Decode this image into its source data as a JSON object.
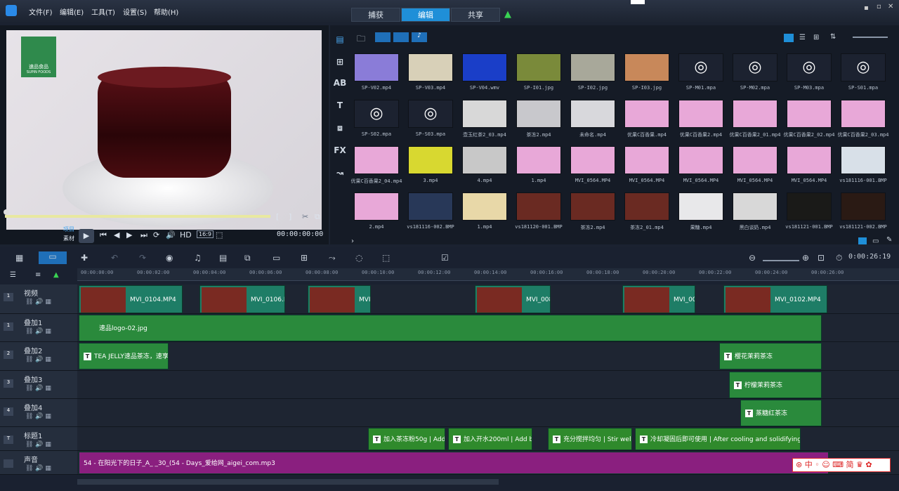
{
  "menu": [
    "文件(F)",
    "编辑(E)",
    "工具(T)",
    "设置(S)",
    "帮助(H)"
  ],
  "tabs": [
    "捕获",
    "编辑",
    "共享"
  ],
  "preview": {
    "logo_text": "速品食品",
    "logo_sub": "SUPIN FOODS",
    "mode_project": "项目",
    "mode_clip": "素材",
    "hd": "HD",
    "aspect": "16:9",
    "timecode": "00:00:00:00"
  },
  "library": {
    "items": [
      {
        "label": "SP-V02.mp4",
        "color": "#8a7cd8"
      },
      {
        "label": "SP-V03.mp4",
        "color": "#d8d0b8"
      },
      {
        "label": "SP-V04.wmv",
        "color": "#1a3ec8"
      },
      {
        "label": "SP-I01.jpg",
        "color": "#7a8a3a"
      },
      {
        "label": "SP-I02.jpg",
        "color": "#a8a89a"
      },
      {
        "label": "SP-I03.jpg",
        "color": "#c8885a"
      },
      {
        "label": "SP-M01.mpa",
        "color": "#1c2230"
      },
      {
        "label": "SP-M02.mpa",
        "color": "#1c2230"
      },
      {
        "label": "SP-M03.mpa",
        "color": "#1c2230"
      },
      {
        "label": "SP-S01.mpa",
        "color": "#1c2230"
      },
      {
        "label": "SP-S02.mpa",
        "color": "#1c2230"
      },
      {
        "label": "SP-S03.mpa",
        "color": "#1c2230"
      },
      {
        "label": "壶玉红茶2_03.mp4",
        "color": "#d8d8d8"
      },
      {
        "label": "茶冻2.mp4",
        "color": "#c8c8cc"
      },
      {
        "label": "未命名.mp4",
        "color": "#d8d8dc"
      },
      {
        "label": "优果C百香果.mp4",
        "color": "#e8a8d8"
      },
      {
        "label": "优果C百香果2.mp4",
        "color": "#e8a8d8"
      },
      {
        "label": "优果C百香果2_01.mp4",
        "color": "#e8a8d8"
      },
      {
        "label": "优果C百香果2_02.mp4",
        "color": "#e8a8d8"
      },
      {
        "label": "优果C百香果2_03.mp4",
        "color": "#e8a8d8"
      },
      {
        "label": "优果C百香果2_04.mp4",
        "color": "#e8a8d8"
      },
      {
        "label": "3.mp4",
        "color": "#d8d830"
      },
      {
        "label": "4.mp4",
        "color": "#c8c8c8"
      },
      {
        "label": "1.mp4",
        "color": "#e8a8d8"
      },
      {
        "label": "MVI_0564.MP4",
        "color": "#e8a8d8"
      },
      {
        "label": "MVI_0564.MP4",
        "color": "#e8a8d8"
      },
      {
        "label": "MVI_0564.MP4",
        "color": "#e8a8d8"
      },
      {
        "label": "MVI_0564.MP4",
        "color": "#e8a8d8"
      },
      {
        "label": "MVI_0564.MP4",
        "color": "#e8a8d8"
      },
      {
        "label": "vs181116-001.BMP",
        "color": "#d8e0e8"
      },
      {
        "label": "2.mp4",
        "color": "#e8a8d8"
      },
      {
        "label": "vs181116-002.BMP",
        "color": "#283858"
      },
      {
        "label": "1.mp4",
        "color": "#e8d8a8"
      },
      {
        "label": "vs181120-001.BMP",
        "color": "#6a2a22"
      },
      {
        "label": "茶冻2.mp4",
        "color": "#6a2a22"
      },
      {
        "label": "茶冻2_01.mp4",
        "color": "#6a2a22"
      },
      {
        "label": "果糖.mp4",
        "color": "#e8e8ea"
      },
      {
        "label": "黑白谈奶.mp4",
        "color": "#d8d8d8"
      },
      {
        "label": "vs181121-001.BMP",
        "color": "#1a1a18"
      },
      {
        "label": "vs181121-002.BMP",
        "color": "#2a1a14"
      }
    ]
  },
  "timeline": {
    "timecode": "0:00:26:19",
    "ruler": [
      "00:00:00:00",
      "00:00:02:00",
      "00:00:04:00",
      "00:00:06:00",
      "00:00:08:00",
      "00:00:10:00",
      "00:00:12:00",
      "00:00:14:00",
      "00:00:16:00",
      "00:00:18:00",
      "00:00:20:00",
      "00:00:22:00",
      "00:00:24:00",
      "00:00:26:00"
    ],
    "tracks": [
      {
        "name": "视频",
        "badge": "1"
      },
      {
        "name": "叠加1",
        "badge": "1"
      },
      {
        "name": "叠加2",
        "badge": "2"
      },
      {
        "name": "叠加3",
        "badge": "3"
      },
      {
        "name": "叠加4",
        "badge": "4"
      },
      {
        "name": "标题1",
        "badge": "T"
      },
      {
        "name": "声音",
        "badge": ""
      }
    ],
    "video_clips": [
      "MVI_0104.MP4",
      "MVI_0106.M",
      "MVI",
      "MVI_008",
      "MVI_00",
      "MVI_0102.MP4"
    ],
    "overlay1": "速品logo-02.jpg",
    "overlay2": [
      "TEA JELLY速品茶冻，速享",
      "樱花茉莉茶冻"
    ],
    "overlay3": "柠檬茉莉茶冻",
    "overlay4": "蒸糖红茶冻",
    "titles": [
      "加入茶冻粉50g | Add 5",
      "加入开水200ml | Add boil",
      "充分搅拌均匀 | Stir well",
      "冷却凝固后即可使用 | After cooling and solidifying, it ca"
    ],
    "audio": "54 - 在阳光下的日子_A_ _30_(54 - Days_爱给网_aigei_com.mp3"
  }
}
